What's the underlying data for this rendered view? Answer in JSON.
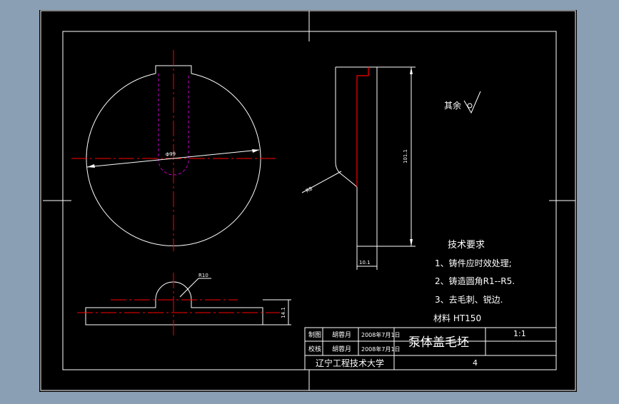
{
  "colors": {
    "background": "#8a9fb4",
    "canvas": "#000000",
    "line": "#ffffff",
    "centerline": "#ff0000",
    "hidden": "#c000c0"
  },
  "dimensions": {
    "diameter": "Φ99",
    "height": "101.1",
    "radius": "R8",
    "width": "10.1",
    "bottom_radius": "R10",
    "bottom_height": "14.1"
  },
  "surface_note": "其余",
  "tech": {
    "title": "技术要求",
    "items": [
      "1、铸件应时效处理;",
      "2、铸造圆角R1--R5.",
      "3、去毛刺、锐边."
    ],
    "material": "材料 HT150"
  },
  "titleblock": {
    "draw_label": "制图",
    "draw_name": "胡蓉月",
    "draw_date": "2008年7月1日",
    "check_label": "校核",
    "check_name": "胡蓉月",
    "check_date": "2008年7月1日",
    "title": "泵体盖毛坯",
    "scale": "1:1",
    "school": "辽宁工程技术大学",
    "number": "4"
  }
}
